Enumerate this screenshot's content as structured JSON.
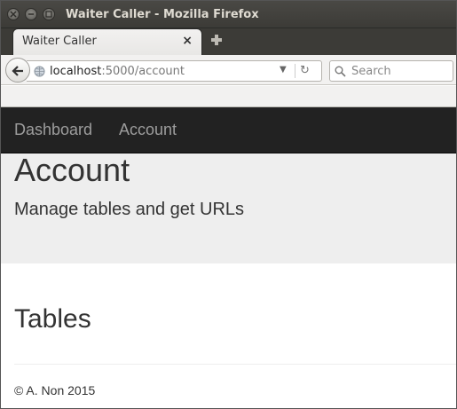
{
  "window": {
    "title": "Waiter Caller - Mozilla Firefox"
  },
  "tabs": [
    {
      "label": "Waiter Caller"
    }
  ],
  "navbar": {
    "url_host": "localhost",
    "url_path": ":5000/account",
    "search_placeholder": "Search"
  },
  "site_nav": {
    "items": [
      {
        "label": "Dashboard"
      },
      {
        "label": "Account"
      }
    ]
  },
  "jumbotron": {
    "title": "Account",
    "subtitle": "Manage tables and get URLs"
  },
  "main": {
    "section_title": "Tables"
  },
  "footer": {
    "text": "© A. Non 2015"
  },
  "colors": {
    "site_nav_bg": "#222222",
    "site_nav_text": "#9d9d9d",
    "jumbotron_bg": "#eeeeee"
  }
}
